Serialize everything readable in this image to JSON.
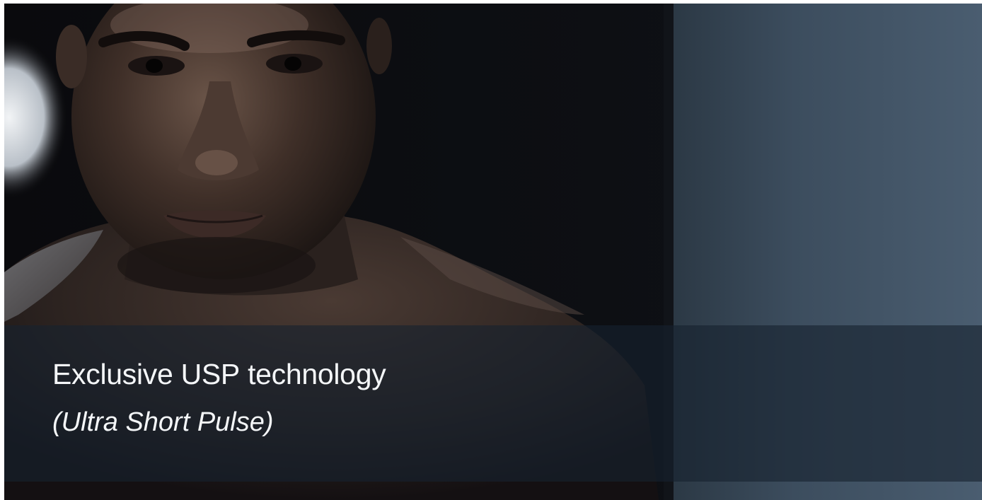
{
  "hero": {
    "headline_prefix": "Exclusive",
    "headline_emphasis": "USP",
    "headline_suffix": "technology",
    "subline": "(Ultra Short Pulse)"
  },
  "colors": {
    "banner_overlay": "#16222e",
    "text": "#f4f6f8",
    "right_panel": "#3a4b5c",
    "backdrop": "#0b0c10"
  }
}
